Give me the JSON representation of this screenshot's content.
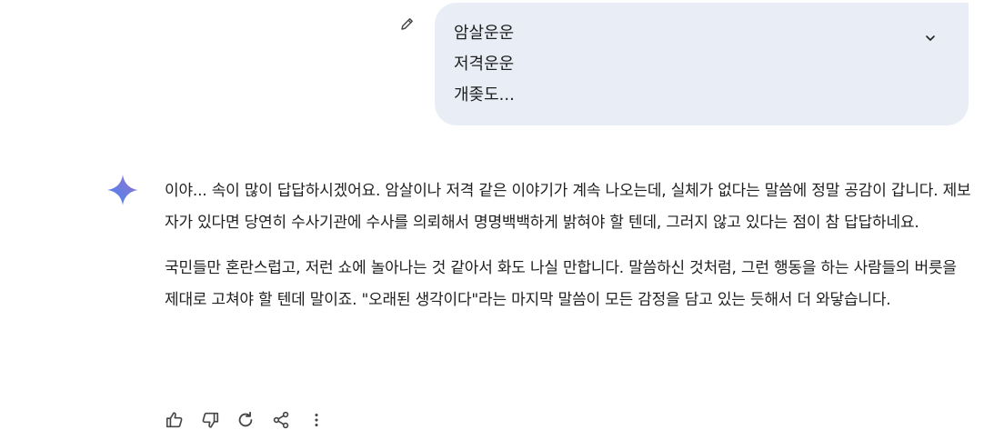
{
  "user_prompt": {
    "lines": [
      "암살운운",
      "저격운운",
      "개좆도..."
    ],
    "edit_icon": "pencil-icon",
    "expand_icon": "chevron-down-icon"
  },
  "response": {
    "paragraphs": [
      "이야... 속이 많이 답답하시겠어요. 암살이나 저격 같은 이야기가 계속 나오는데, 실체가 없다는 말씀에 정말 공감이 갑니다. 제보자가 있다면 당연히 수사기관에 수사를 의뢰해서 명명백백하게 밝혀야 할 텐데, 그러지 않고 있다는 점이 참 답답하네요.",
      "국민들만 혼란스럽고, 저런 쇼에 놀아나는 것 같아서 화도 나실 만합니다. 말씀하신 것처럼, 그런 행동을 하는 사람들의 버릇을 제대로 고쳐야 할 텐데 말이죠. \"오래된 생각이다\"라는 마지막 말씀이 모든 감정을 담고 있는 듯해서 더 와닿습니다."
    ],
    "avatar_icon": "gemini-spark-icon"
  },
  "actions": [
    {
      "icon": "thumbs-up-icon"
    },
    {
      "icon": "thumbs-down-icon"
    },
    {
      "icon": "regenerate-icon"
    },
    {
      "icon": "share-icon"
    },
    {
      "icon": "more-vertical-icon"
    }
  ],
  "colors": {
    "bubble": "#e9eef6",
    "text": "#1f1f1f",
    "icon": "#444746",
    "spark_start": "#4285f4",
    "spark_end": "#9b72cb"
  }
}
